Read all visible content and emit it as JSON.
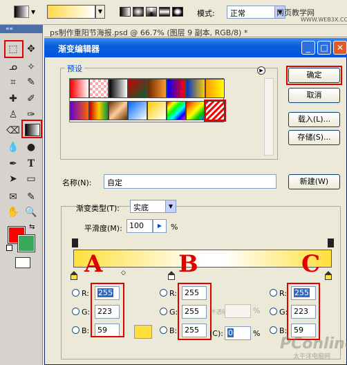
{
  "options_bar": {
    "mode_label": "模式:",
    "mode_value": "正常",
    "watermark": "网页教学网",
    "watermark_url": "WWW.WEB3X.COM"
  },
  "document": {
    "tab_title": "ps制作重阳节海报.psd @ 66.7% (图层 9 副本, RGB/8) *"
  },
  "dialog": {
    "title": "渐变编辑器",
    "window_buttons": {
      "minimize": "_",
      "maximize": "□",
      "close": "✕"
    },
    "presets_label": "预设",
    "buttons": {
      "ok": "确定",
      "cancel": "取消",
      "load": "载入(L)...",
      "save": "存储(S)...",
      "new": "新建(W)"
    },
    "name_label": "名称(N):",
    "name_value": "自定",
    "gradient_type_label": "渐变类型(T):",
    "gradient_type_value": "实底",
    "smoothness_label": "平滑度(M):",
    "smoothness_value": "100",
    "smoothness_unit": "%",
    "markers": [
      "A",
      "B",
      "C"
    ],
    "color_stops": [
      {
        "r": "255",
        "g": "223",
        "b": "59"
      },
      {
        "r": "255",
        "g": "255",
        "b": "255"
      },
      {
        "r": "255",
        "g": "223",
        "b": "59"
      }
    ],
    "channel_labels": {
      "r": "R:",
      "g": "G:",
      "b": "B:"
    },
    "location_label": "(C):",
    "location_value": "0",
    "opacity_label": "不透明度:",
    "percent": "%",
    "watermark": "PConline",
    "watermark_sub": "太平洋电脑网"
  },
  "colors": {
    "accent_red": "#e00000",
    "stop_yellow": "#ffdf3b",
    "foreground": "#ff0000",
    "background": "#3aa85a",
    "titlebar": "#0055e5"
  },
  "icons": [
    "gradient-tool-icon",
    "marquee-icon",
    "move-icon",
    "lasso-icon",
    "magic-wand-icon",
    "crop-icon",
    "slice-icon",
    "healing-icon",
    "brush-icon",
    "stamp-icon",
    "history-brush-icon",
    "eraser-icon",
    "blur-icon",
    "dodge-icon",
    "pen-icon",
    "type-icon",
    "path-select-icon",
    "shape-icon",
    "notes-icon",
    "eyedropper-icon",
    "hand-icon",
    "zoom-icon",
    "quickmask-icon"
  ]
}
